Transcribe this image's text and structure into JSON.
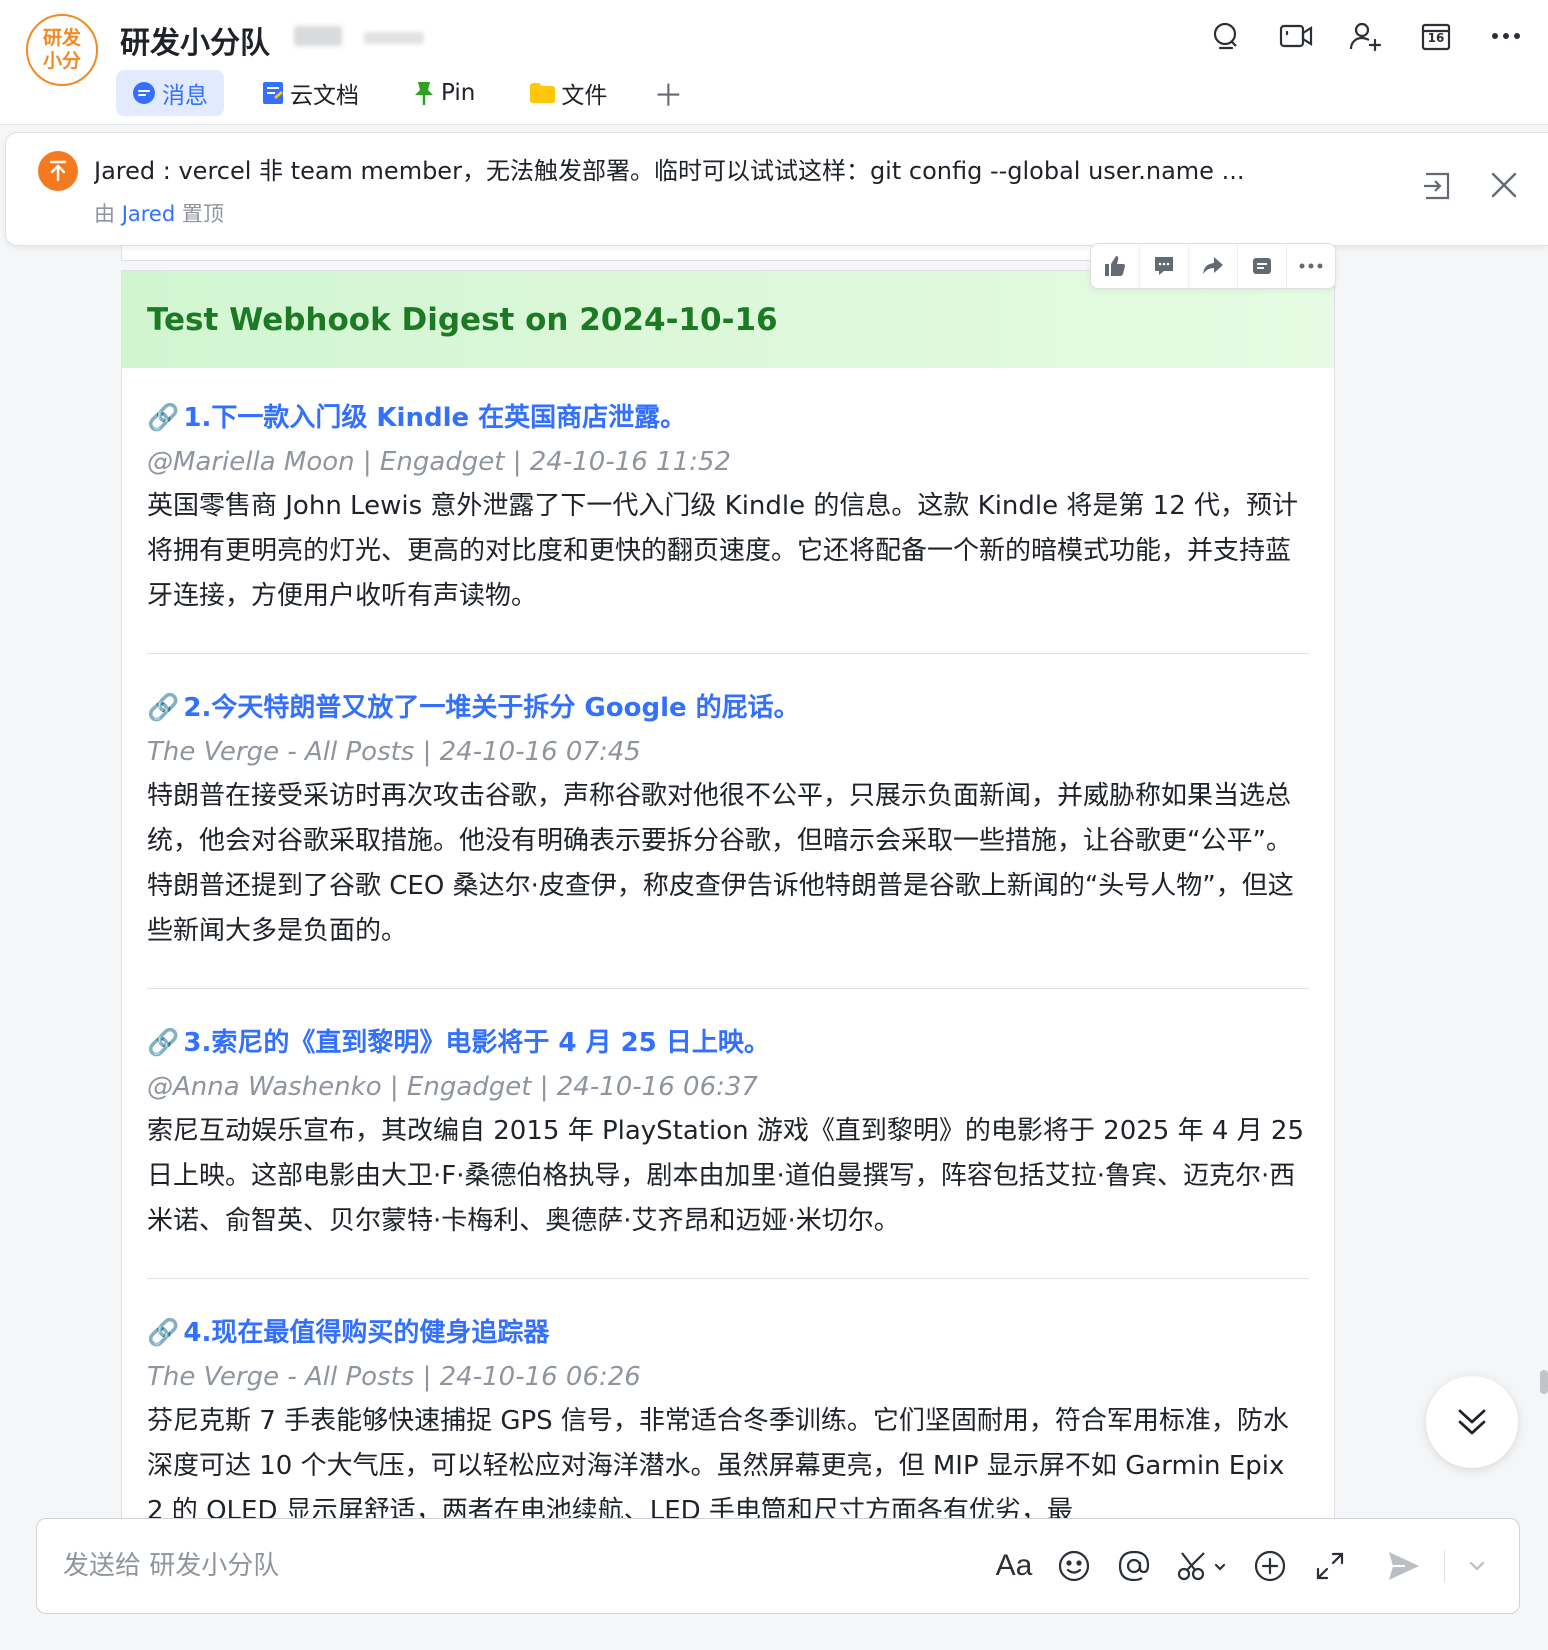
{
  "chat": {
    "avatar_line1": "研发",
    "avatar_line2": "小分",
    "title": "研发小分队"
  },
  "tabs": [
    {
      "label": "消息",
      "icon": "chat-bubble-icon",
      "active": true
    },
    {
      "label": "云文档",
      "icon": "doc-icon"
    },
    {
      "label": "Pin",
      "icon": "pushpin-icon"
    },
    {
      "label": "文件",
      "icon": "folder-icon"
    }
  ],
  "header_actions": [
    "search-icon",
    "video-call-icon",
    "add-member-icon",
    "calendar-icon",
    "more-icon"
  ],
  "calendar_day": "16",
  "pinned": {
    "text": "Jared : vercel 非 team member，无法触发部署。临时可以试试这样：git config --global user.name ...",
    "by_prefix": "由",
    "by_name": "Jared",
    "by_suffix": "置顶"
  },
  "card": {
    "title": "Test Webhook Digest on 2024-10-16",
    "items": [
      {
        "title": "1.下一款入门级 Kindle 在英国商店泄露。",
        "meta": "@Mariella Moon | Engadget | 24-10-16 11:52",
        "desc": "英国零售商 John Lewis 意外泄露了下一代入门级 Kindle 的信息。这款 Kindle 将是第 12 代，预计将拥有更明亮的灯光、更高的对比度和更快的翻页速度。它还将配备一个新的暗模式功能，并支持蓝牙连接，方便用户收听有声读物。"
      },
      {
        "title": "2.今天特朗普又放了一堆关于拆分 Google 的屁话。",
        "meta": "The Verge -  All Posts | 24-10-16 07:45",
        "desc": "特朗普在接受采访时再次攻击谷歌，声称谷歌对他很不公平，只展示负面新闻，并威胁称如果当选总统，他会对谷歌采取措施。他没有明确表示要拆分谷歌，但暗示会采取一些措施，让谷歌更“公平”。特朗普还提到了谷歌 CEO 桑达尔·皮查伊，称皮查伊告诉他特朗普是谷歌上新闻的“头号人物”，但这些新闻大多是负面的。"
      },
      {
        "title": "3.索尼的《直到黎明》电影将于 4 月 25 日上映。",
        "meta": "@Anna Washenko | Engadget | 24-10-16 06:37",
        "desc": "索尼互动娱乐宣布，其改编自 2015 年 PlayStation 游戏《直到黎明》的电影将于 2025 年 4 月 25 日上映。这部电影由大卫·F·桑德伯格执导，剧本由加里·道伯曼撰写，阵容包括艾拉·鲁宾、迈克尔·西米诺、俞智英、贝尔蒙特·卡梅利、奥德萨·艾齐昂和迈娅·米切尔。"
      },
      {
        "title": "4.现在最值得购买的健身追踪器",
        "meta": "The Verge -  All Posts | 24-10-16 06:26",
        "desc": "芬尼克斯 7 手表能够快速捕捉 GPS 信号，非常适合冬季训练。它们坚固耐用，符合军用标准，防水深度可达 10 个大气压，可以轻松应对海洋潜水。虽然屏幕更亮，但 MIP 显示屏不如 Garmin Epix 2 的 OLED 显示屏舒适，两者在电池续航、LED 手电筒和尺寸方面各有优劣，最"
      }
    ]
  },
  "toolbar": [
    "thumbs-up-icon",
    "reply-icon",
    "forward-icon",
    "quote-icon",
    "more-icon"
  ],
  "composer": {
    "placeholder": "发送给 研发小分队",
    "font_label": "Aa"
  },
  "colors": {
    "accent": "#3370ff",
    "card_title": "#1b7a23",
    "pin_icon": "#f4791f",
    "avatar": "#f08a24"
  }
}
